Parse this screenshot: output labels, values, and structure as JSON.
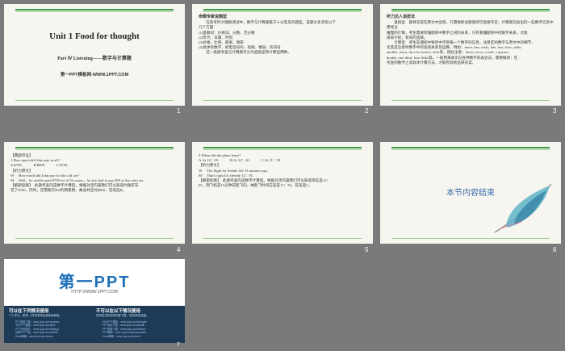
{
  "slides": [
    {
      "num": "1",
      "title": "Unit 1    Food for thought",
      "subtitle": "Part Ⅳ   Listening——数字与计算题",
      "footer": "第一PPT模板网-WWW.1PPT.COM"
    },
    {
      "num": "2",
      "heading": "命题专家说题型",
      "lines": [
        "　　在高考听力理解测试中，数字与计算题属于十分常见的题型，该题大多涉及以下",
        "几个方面：",
        "(1)基数词：价格词、分数、百分数",
        "(2)年代、日期、时刻",
        "(3)价格、比例、距离、频率",
        "(4)具体的数字，如电话号码、班级、楼层、房间号",
        "　　这一类题考查与计算题可分为直接型和计算型两种。"
      ]
    },
    {
      "num": "3",
      "heading": "听力达人谈技法",
      "lines": [
        "　　直接型　题目答案在原文中出现，只需要抓住题意即可直接作答；计算题在给出的一些数字信息中需经过",
        "推理的计算，考生需要听懂题目中数字之间的关系，只有看懂题目中的数字关系，才能",
        "排除干扰，有效的选择。",
        "　　计算型　考生在捕捉中要听中学到每一个数字的信息，注意区别数字与原文中的细节，",
        "尤其是注意听数字中的加减关系及运算，例如：more, less, early, late, fast, slow, older,",
        "another, extra, the rest, before, after等。因此注意：times, twice, a half, a quarter,",
        "double, one third, four fifths等。一般用来表示与各种数字的表达法，需要做到：在",
        "考查的数字之间具体计算方法，才能有效地选择答案。"
      ]
    },
    {
      "num": "4",
      "lines": [
        "【典题印证】",
        "1.How much did John pay in all?",
        "A.$700.　　　B.$800.　　　C.$750.",
        "【听力原文】",
        "W:　How much did John pay for this old car?",
        "M:　Well，he said he paid $700 for it.Of course，he also had to pay $50 as the sales tax.",
        "【解题思路】　此题考查的是数字计算型。根据对话内容我们可以知道约翰买车",
        "花了$700，同时，还需要交$50的销售税，故总共应付$800，答案选B。"
      ]
    },
    {
      "num": "5",
      "lines": [
        "2.When did the plane leave?",
        "A.At 12：05.　　　B.At 12：20.　　　C.At 11：50.",
        "【听力原文】",
        "W:　The flight for Seattle left 15 minutes ago.",
        "M:　That's right.It's already 12：05.",
        "【解题思路】　此题考查的是数字计算型。根据对话内容我们可以知道现在是12：",
        "05，而飞机是15分钟前起飞的，故起飞时间应该是11：50，答案选C。"
      ]
    },
    {
      "num": "6",
      "text": "本节内容结束"
    },
    {
      "num": "7",
      "logo": "第一PPT",
      "url": "HTTP://WWW.1PPT.COM",
      "col1_title": "可以在下列情况使用",
      "col1_small": "个人学习、研究。/任何非商业用途的使用。",
      "col2_title": "不可以在以下情况使用",
      "col2_small": "任何形式的在线付费下载。/任何商业用途。",
      "links1": [
        "PPT模板下载：www.1ppt.com/moban/",
        "节日PPT模板：www.1ppt.com/jieri/",
        "PPT背景图片：www.1ppt.com/beijing/",
        "优秀PPT下载：www.1ppt.com/xiazai/",
        "Word教程：www.1ppt.com/word/",
        "资料下载：www.1ppt.com/ziliao/",
        "范文下载：www.1ppt.com/fanwen/",
        "教案下载：www.1ppt.com/jiaoan/",
        "字体下载：www.1ppt.com/ziti/"
      ],
      "links2": [
        "行业PPT模板：www.1ppt.com/hangye/",
        "PPT素材下载：www.1ppt.com/sucai/",
        "PPT图表下载：www.1ppt.com/tubiao/",
        "PPT教程：www.1ppt.com/powerpoint/",
        "Excel教程：www.1ppt.com/excel/",
        "PPT课件：www.1ppt.com/kejian/",
        "试卷下载：www.1ppt.com/shiti/",
        "手抄报：www.1ppt.com/shouchaobao/",
        "个人简历：www.1ppt.com/jianli/"
      ]
    }
  ]
}
